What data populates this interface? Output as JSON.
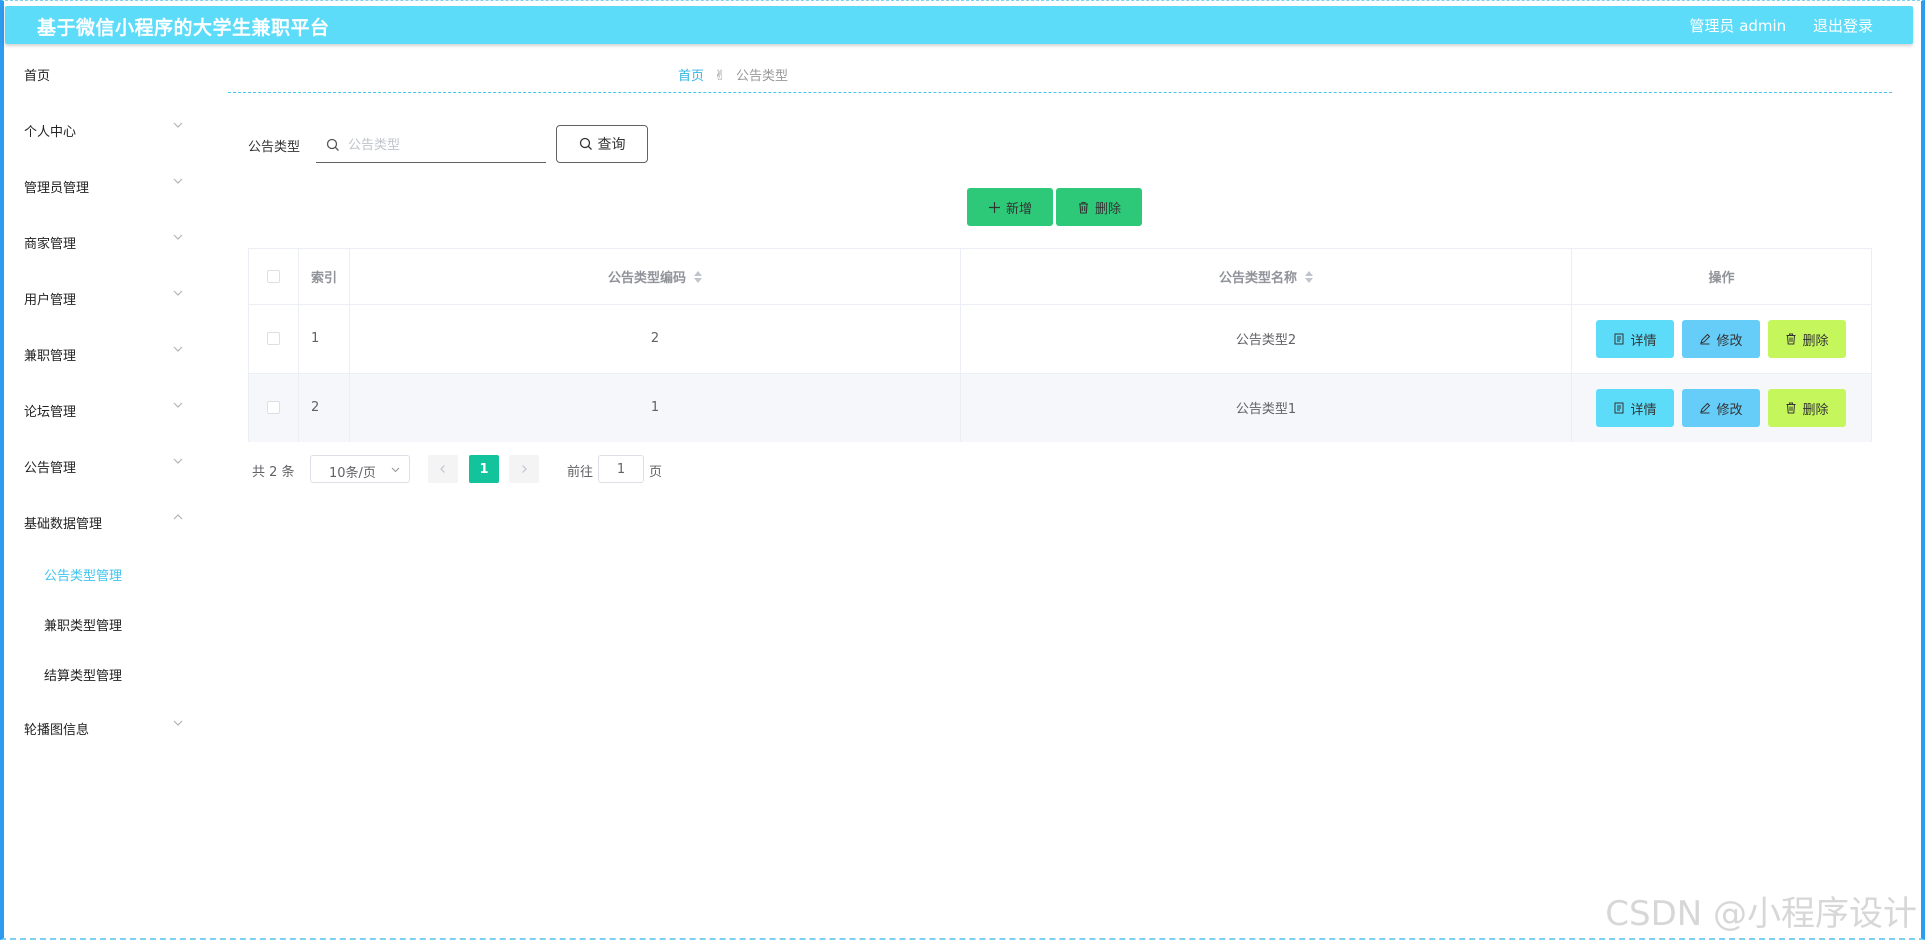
{
  "header": {
    "title": "基于微信小程序的大学生兼职平台",
    "admin_label": "管理员 admin",
    "logout_label": "退出登录"
  },
  "sidebar": {
    "items": [
      {
        "label": "首页"
      },
      {
        "label": "个人中心"
      },
      {
        "label": "管理员管理"
      },
      {
        "label": "商家管理"
      },
      {
        "label": "用户管理"
      },
      {
        "label": "兼职管理"
      },
      {
        "label": "论坛管理"
      },
      {
        "label": "公告管理"
      },
      {
        "label": "基础数据管理"
      },
      {
        "label": "公告类型管理"
      },
      {
        "label": "兼职类型管理"
      },
      {
        "label": "结算类型管理"
      },
      {
        "label": "轮播图信息"
      }
    ]
  },
  "breadcrumb": {
    "home": "首页",
    "current": "公告类型"
  },
  "search": {
    "label": "公告类型",
    "placeholder": "公告类型",
    "value": "",
    "query_label": "查询"
  },
  "actions": {
    "add_label": "新增",
    "delete_label": "删除"
  },
  "table": {
    "headers": {
      "index": "索引",
      "code": "公告类型编码",
      "name": "公告类型名称",
      "ops": "操作"
    },
    "rows": [
      {
        "index": "1",
        "code": "2",
        "name": "公告类型2"
      },
      {
        "index": "2",
        "code": "1",
        "name": "公告类型1"
      }
    ],
    "row_buttons": {
      "detail": "详情",
      "edit": "修改",
      "delete": "删除"
    }
  },
  "pagination": {
    "total_text": "共 2 条",
    "page_size": "10条/页",
    "current_page": "1",
    "goto_prefix": "前往",
    "goto_value": "1",
    "goto_suffix": "页"
  },
  "watermark": "CSDN @小程序设计",
  "colors": {
    "header_bg": "#5ddcf9",
    "accent": "#3fc5f0",
    "green_button": "#2dc979",
    "detail_button": "#5ddcf9",
    "edit_button": "#66ccf8",
    "delete_button": "#c5f75d",
    "pager_active": "#13c39b"
  }
}
